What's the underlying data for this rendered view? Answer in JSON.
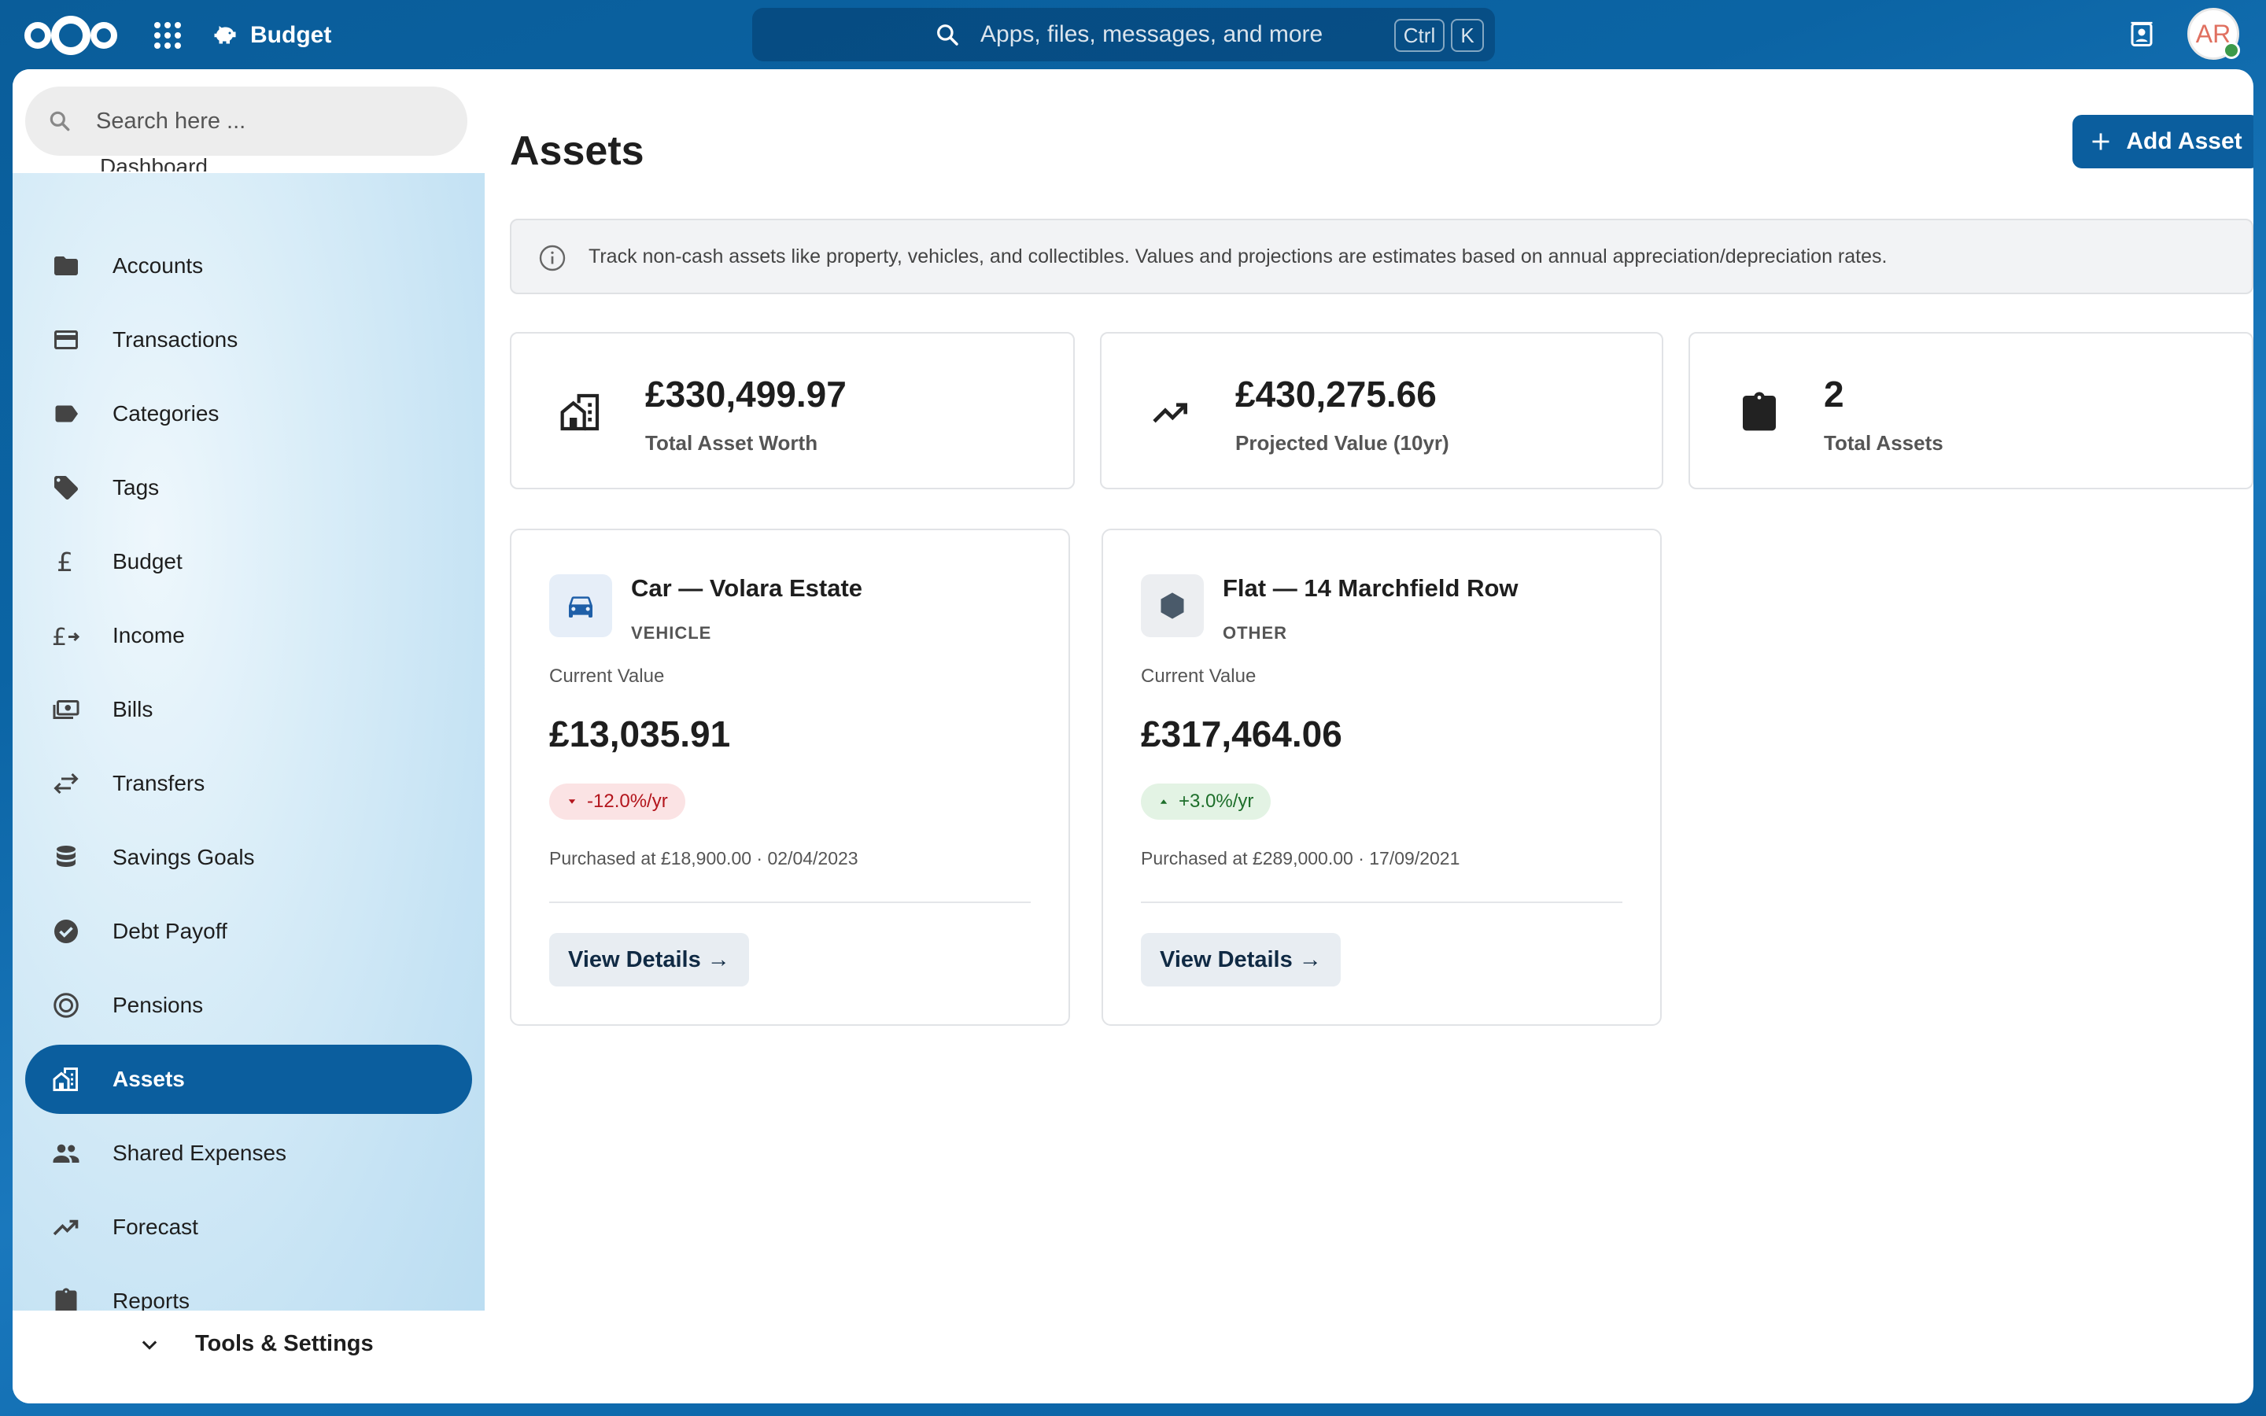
{
  "header": {
    "app_name": "Budget",
    "search_placeholder": "Apps, files, messages, and more",
    "kbd_ctrl": "Ctrl",
    "kbd_k": "K",
    "avatar_initials": "AR"
  },
  "sidebar": {
    "search_placeholder": "Search here ...",
    "partial_item": "Dashboard",
    "items": [
      {
        "label": "Accounts",
        "icon": "folder-icon"
      },
      {
        "label": "Transactions",
        "icon": "credit-card-icon"
      },
      {
        "label": "Categories",
        "icon": "label-icon"
      },
      {
        "label": "Tags",
        "icon": "tag-icon"
      },
      {
        "label": "Budget",
        "icon": "pound-icon"
      },
      {
        "label": "Income",
        "icon": "pound-arrow-icon"
      },
      {
        "label": "Bills",
        "icon": "cash-icon"
      },
      {
        "label": "Transfers",
        "icon": "swap-icon"
      },
      {
        "label": "Savings Goals",
        "icon": "database-icon"
      },
      {
        "label": "Debt Payoff",
        "icon": "check-circle-icon"
      },
      {
        "label": "Pensions",
        "icon": "target-icon"
      },
      {
        "label": "Assets",
        "icon": "home-city-icon",
        "active": true
      },
      {
        "label": "Shared Expenses",
        "icon": "people-icon"
      },
      {
        "label": "Forecast",
        "icon": "trend-icon"
      },
      {
        "label": "Reports",
        "icon": "clipboard-icon"
      }
    ],
    "tools_label": "Tools & Settings"
  },
  "main": {
    "title": "Assets",
    "add_button": "Add Asset",
    "info_text": "Track non-cash assets like property, vehicles, and collectibles. Values and projections are estimates based on annual appreciation/depreciation rates.",
    "stats": [
      {
        "value": "£330,499.97",
        "caption": "Total Asset Worth",
        "icon": "home-city-icon"
      },
      {
        "value": "£430,275.66",
        "caption": "Projected Value (10yr)",
        "icon": "trend-icon"
      },
      {
        "value": "2",
        "caption": "Total Assets",
        "icon": "clipboard-icon"
      }
    ],
    "assets": [
      {
        "name": "Car — Volara Estate",
        "type": "VEHICLE",
        "current_value_label": "Current Value",
        "current_value": "£13,035.91",
        "rate": "-12.0%/yr",
        "purchased": "Purchased at £18,900.00 · 02/04/2023",
        "view_label": "View Details →",
        "icon": "car-icon"
      },
      {
        "name": "Flat — 14 Marchfield Row",
        "type": "OTHER",
        "current_value_label": "Current Value",
        "current_value": "£317,464.06",
        "rate": "+3.0%/yr",
        "purchased": "Purchased at £289,000.00 · 17/09/2021",
        "view_label": "View Details →",
        "icon": "hexagon-icon"
      }
    ]
  },
  "colors": {
    "primary": "#0b5e9e",
    "negative_bg": "#fbe3e4",
    "negative_text": "#b3151c",
    "positive_bg": "#e3f3e4",
    "positive_text": "#1d6e2a"
  }
}
